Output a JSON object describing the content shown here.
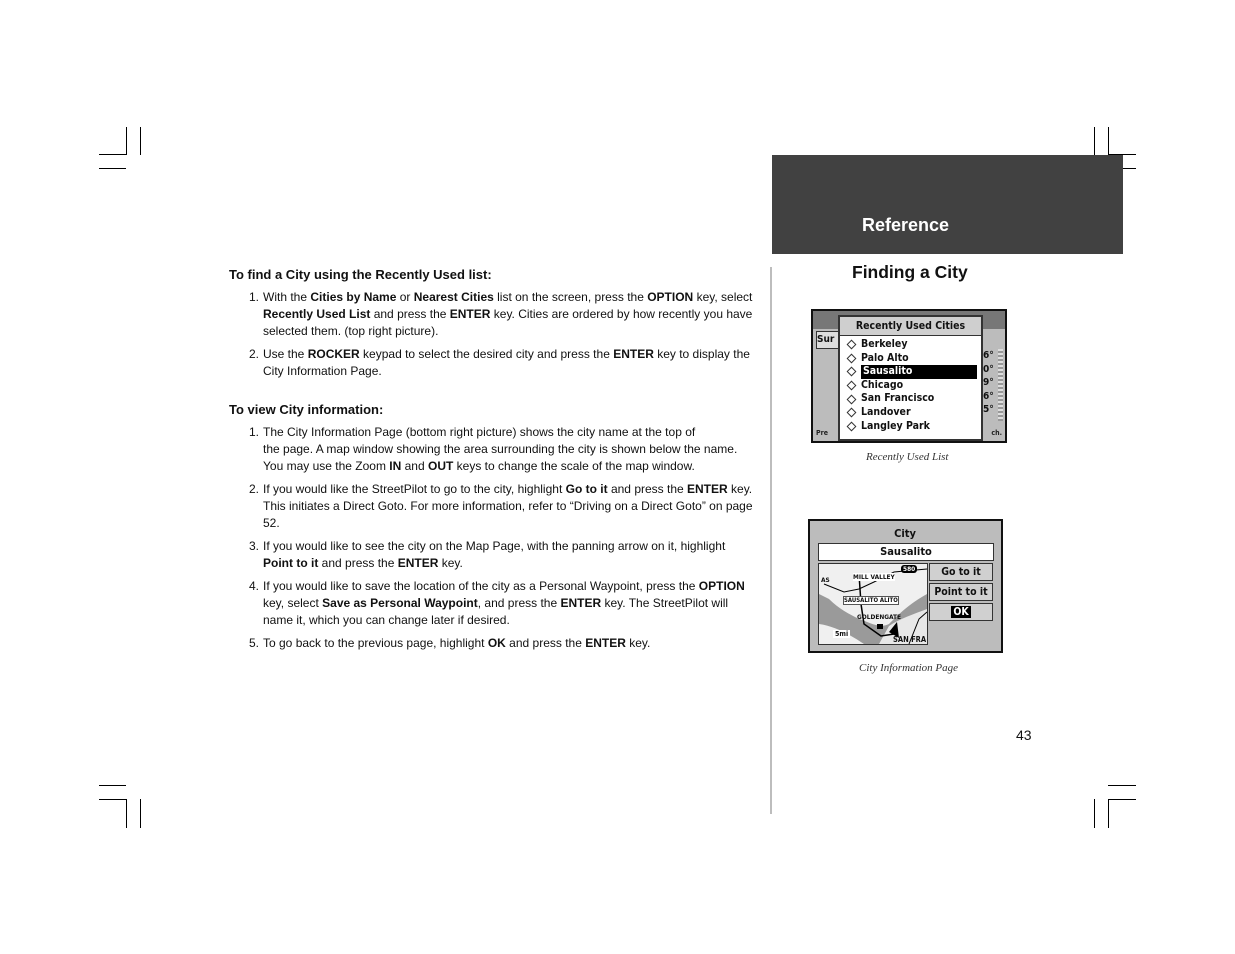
{
  "header": {
    "section_label": "Reference",
    "page_title": "Finding a City"
  },
  "recently_used": {
    "heading": "To find a City using the Recently Used list:",
    "steps": [
      {
        "num": "1.",
        "parts": [
          {
            "t": "With the "
          },
          {
            "b": "Cities by Name"
          },
          {
            "t": " or "
          },
          {
            "b": "Nearest Cities"
          },
          {
            "t": " list on the screen, press the "
          },
          {
            "b": "OPTION"
          },
          {
            "t": " key, select "
          },
          {
            "b": "Recently Used List"
          },
          {
            "t": " and press the "
          },
          {
            "b": "ENTER"
          },
          {
            "t": " key. Cities are ordered by how recently you have selected them. (top right picture)."
          }
        ]
      },
      {
        "num": "2.",
        "parts": [
          {
            "t": "Use the "
          },
          {
            "b": "ROCKER"
          },
          {
            "t": " keypad to select the desired city and press the "
          },
          {
            "b": "ENTER"
          },
          {
            "t": " key to display the City Information Page."
          }
        ]
      }
    ]
  },
  "city_info": {
    "heading": "To view City information:",
    "steps": [
      {
        "num": "1.",
        "parts": [
          {
            "t": "The City Information Page (bottom right picture) shows the city name at the top of "
          },
          {
            "br": true
          },
          {
            "t": "the page.  A map window showing the area surrounding the city is shown below the name.  You may use the Zoom "
          },
          {
            "b": "IN"
          },
          {
            "t": " and "
          },
          {
            "b": "OUT"
          },
          {
            "t": " keys to change the scale of the map window."
          }
        ]
      },
      {
        "num": "2.",
        "parts": [
          {
            "t": "If you would like the StreetPilot to go to the city, highlight "
          },
          {
            "b": "Go to it"
          },
          {
            "t": " and press the "
          },
          {
            "b": "ENTER"
          },
          {
            "t": " key. This initiates a Direct Goto.  For more information, refer to “Driving on a Direct Goto” on page 52."
          }
        ]
      },
      {
        "num": "3.",
        "parts": [
          {
            "t": "If you would like to see the city on the Map Page, with the panning arrow on it, highlight "
          },
          {
            "b": "Point to it"
          },
          {
            "t": " and press the "
          },
          {
            "b": "ENTER"
          },
          {
            "t": " key."
          }
        ]
      },
      {
        "num": "4.",
        "parts": [
          {
            "t": "If you would like to save the location of the city as a Personal Waypoint, press the "
          },
          {
            "b": "OPTION"
          },
          {
            "t": " key, select "
          },
          {
            "b": "Save as Personal Waypoint"
          },
          {
            "t": ", and press the "
          },
          {
            "b": "ENTER"
          },
          {
            "t": " key.  The StreetPilot will name it, which you can change later if desired."
          }
        ]
      },
      {
        "num": "5.",
        "parts": [
          {
            "t": "To go back to the previous page, highlight "
          },
          {
            "b": "OK"
          },
          {
            "t": " and press the "
          },
          {
            "b": "ENTER"
          },
          {
            "t": " key."
          }
        ]
      }
    ]
  },
  "figure1": {
    "caption": "Recently Used List",
    "popup_title": "Recently Used Cities",
    "background_header": "Sur",
    "background_footer_left": "Pre",
    "background_footer_right": "ch.",
    "right_column": [
      "6°",
      "0°",
      "9°",
      "6°",
      "5°"
    ],
    "cities": [
      "Berkeley",
      "Palo Alto",
      "Sausalito",
      "Chicago",
      "San Francisco",
      "Landover",
      "Langley Park"
    ],
    "selected_index": 2
  },
  "figure2": {
    "caption": "City Information Page",
    "title": "City",
    "city_name": "Sausalito",
    "buttons": [
      "Go to it",
      "Point to it",
      "OK"
    ],
    "map_labels": {
      "hill_valley": "MILL VALLEY",
      "highway": "580",
      "sausalito": "SAUSALITO ALITO",
      "golden_gate": "GOLDENGATE",
      "san_fran": "SAN FRA",
      "left_edge": "AS",
      "scale": "5mi"
    }
  },
  "page_number": "43"
}
